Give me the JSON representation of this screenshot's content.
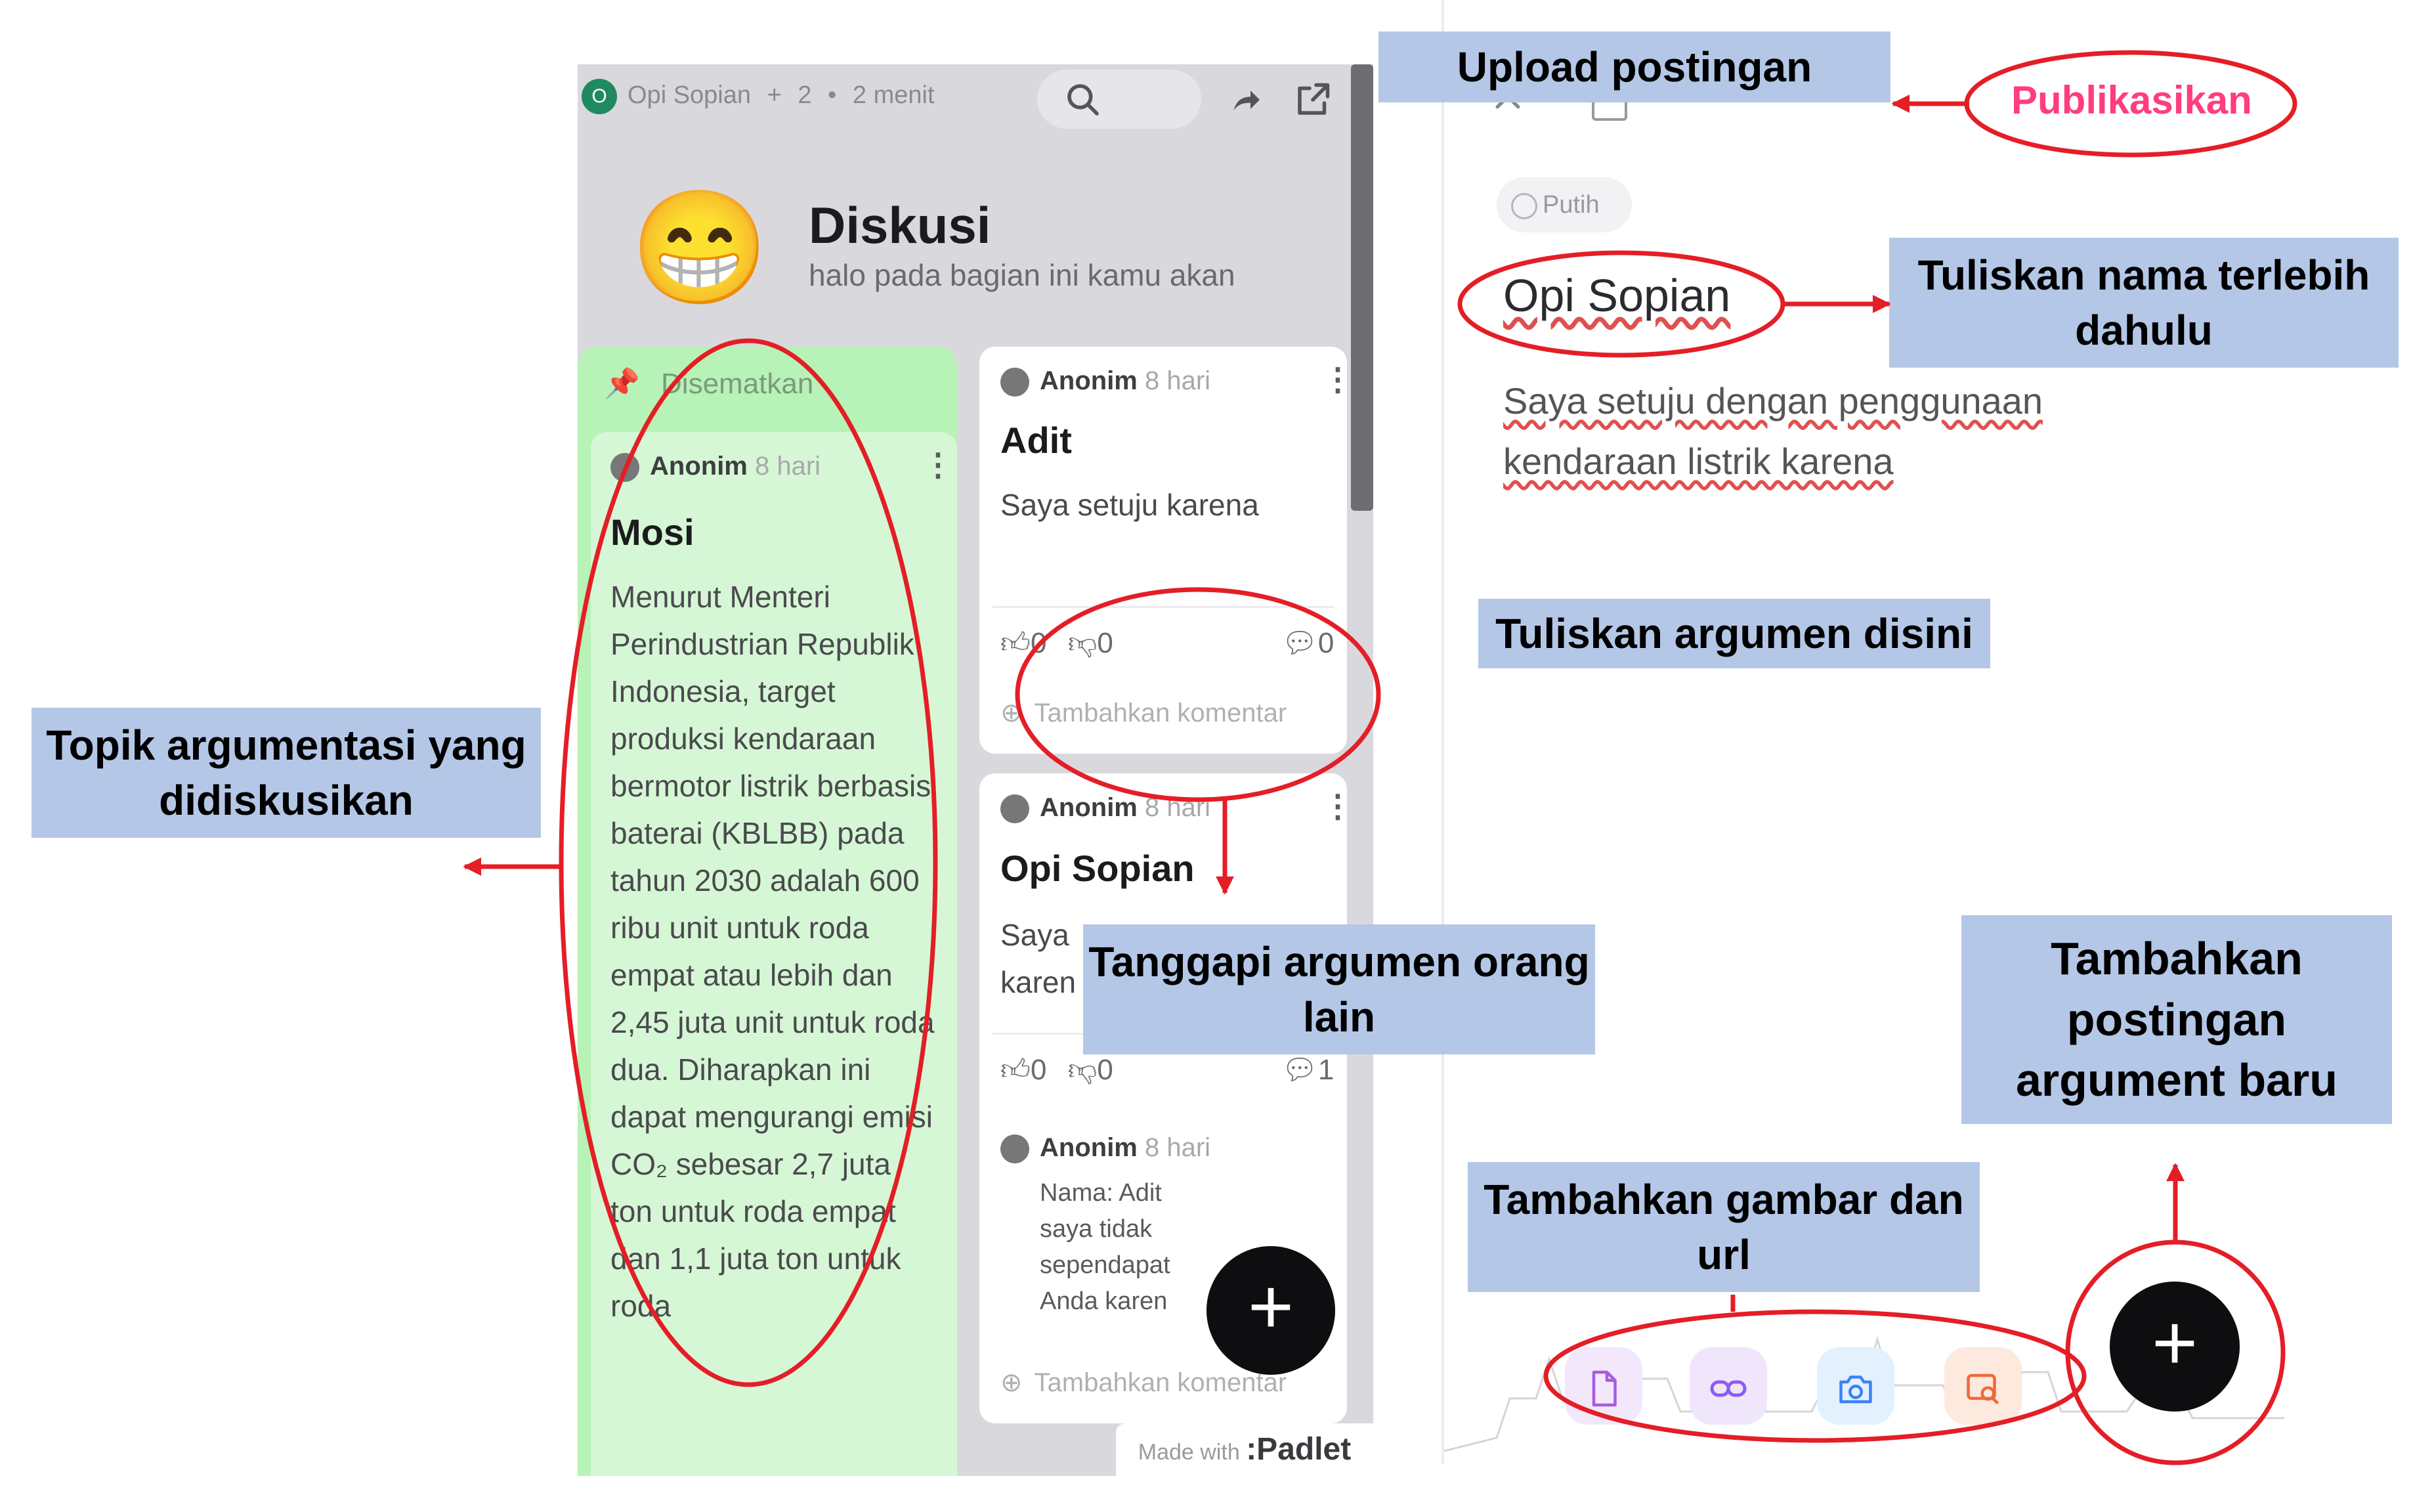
{
  "board": {
    "author": "Opi Sopian",
    "avatar_letter": "O",
    "contributors": "2",
    "time": "2 menit",
    "emoji": "😁",
    "title": "Diskusi",
    "subtitle": "halo pada bagian ini kamu akan",
    "pinned_label": "Disematkan",
    "footer_made_with": "Made with",
    "footer_brand": ":Padlet"
  },
  "posts": {
    "mosi": {
      "author": "Anonim",
      "time": "8 hari",
      "title": "Mosi",
      "body": "Menurut Menteri Perindustrian Republik Indonesia, target produksi kendaraan bermotor listrik berbasis baterai (KBLBB) pada tahun 2030 adalah 600 ribu unit untuk roda empat atau lebih dan 2,45 juta unit untuk roda dua. Diharapkan ini dapat mengurangi emisi CO₂ sebesar 2,7 juta ton untuk roda empat dan 1,1 juta ton untuk roda"
    },
    "adit": {
      "author": "Anonim",
      "time": "8 hari",
      "title": "Adit",
      "body": "Saya setuju karena",
      "likes": "0",
      "dislikes": "0",
      "comments": "0",
      "add_comment": "Tambahkan komentar"
    },
    "opi": {
      "author": "Anonim",
      "time": "8 hari",
      "title": "Opi Sopian",
      "body_line1": "Saya",
      "body_line2": "karen",
      "likes": "0",
      "dislikes": "0",
      "comments": "1",
      "comment_author": "Anonim",
      "comment_time": "8 hari",
      "comment_text": [
        "Nama: Adit",
        "saya tidak",
        "sependapat",
        "Anda karen"
      ],
      "add_comment": "Tambahkan komentar"
    }
  },
  "editor": {
    "color_chip": "Putih",
    "name_value": "Opi Sopian",
    "body_line1": "Saya setuju dengan penggunaan",
    "body_line2": "kendaraan listrik karena",
    "publish_label": "Publikasikan"
  },
  "annotations": {
    "upload": "Upload postingan",
    "write_name": "Tuliskan nama terlebih dahulu",
    "write_argument": "Tuliskan argumen disini",
    "topic": "Topik argumentasi yang didiskusikan",
    "respond": "Tanggapi argumen orang lain",
    "add_post": "Tambahkan postingan argument baru",
    "add_media": "Tambahkan gambar dan url"
  },
  "colors": {
    "annotation_box": "#b4c7e7",
    "annotation_red": "#e41e26",
    "publish_pink": "#ff3d7f",
    "pinned_green": "#b7f2b6"
  },
  "icons": [
    "search-icon",
    "share-icon",
    "open-external-icon",
    "pin-icon",
    "more-vertical-icon",
    "thumbs-up-icon",
    "thumbs-down-icon",
    "comment-icon",
    "plus-icon",
    "close-icon",
    "file-icon",
    "link-icon",
    "camera-icon",
    "image-search-icon"
  ]
}
